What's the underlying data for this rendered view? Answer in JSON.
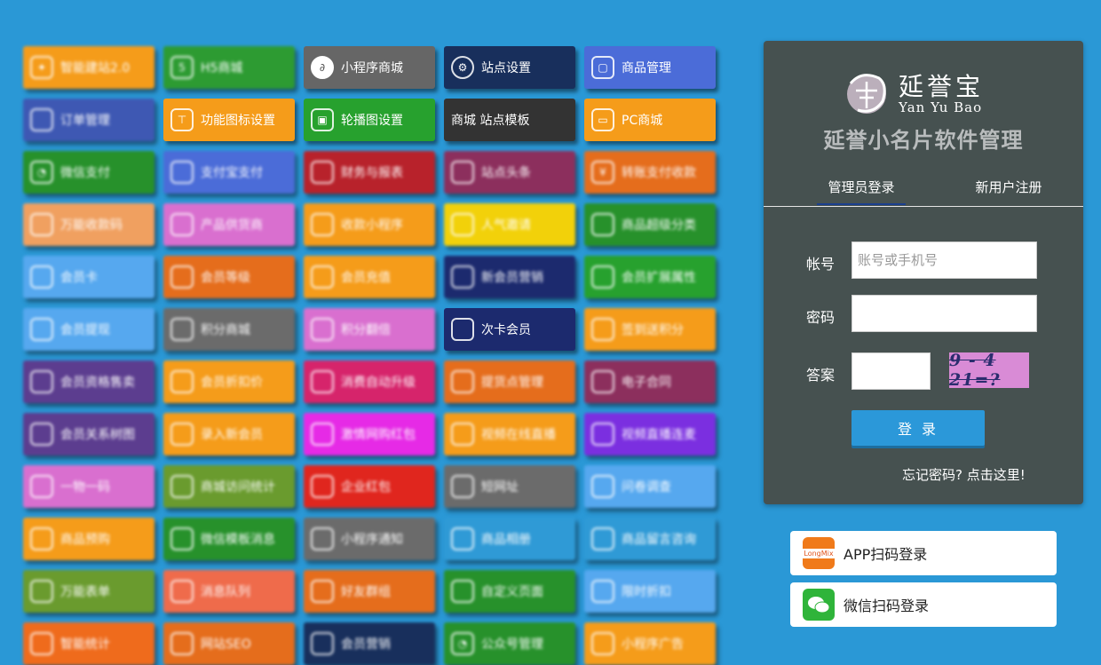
{
  "tiles": [
    {
      "label": "智能建站2.0",
      "color": "#f59c1a",
      "icon": "star-hex-icon",
      "blur": true
    },
    {
      "label": "H5商城",
      "color": "#2d9b32",
      "icon": "html5-icon",
      "blur": true
    },
    {
      "label": "小程序商城",
      "color": "#666666",
      "icon": "mini-program-icon",
      "blur": false
    },
    {
      "label": "站点设置",
      "color": "#182f5c",
      "icon": "gear-icon",
      "blur": false
    },
    {
      "label": "商品管理",
      "color": "#4b6cd8",
      "icon": "bag-icon",
      "blur": false
    },
    {
      "label": "订单管理",
      "color": "#3e58b3",
      "icon": "user-list-icon",
      "blur": true
    },
    {
      "label": "功能图标设置",
      "color": "#f59c1a",
      "icon": "signpost-icon",
      "blur": false
    },
    {
      "label": "轮播图设置",
      "color": "#27a12e",
      "icon": "image-icon",
      "blur": false
    },
    {
      "label": "商城 站点模板",
      "color": "#333333",
      "icon": "",
      "blur": false
    },
    {
      "label": "PC商城",
      "color": "#f59c1a",
      "icon": "monitor-icon",
      "blur": false
    },
    {
      "label": "微信支付",
      "color": "#27912b",
      "icon": "wechat-icon",
      "blur": true
    },
    {
      "label": "支付宝支付",
      "color": "#4b6cd8",
      "icon": "alipay-icon",
      "blur": true
    },
    {
      "label": "财务与报表",
      "color": "#b8222b",
      "icon": "report-icon",
      "blur": true
    },
    {
      "label": "站点头条",
      "color": "#8c2f5d",
      "icon": "grid-icon",
      "blur": true
    },
    {
      "label": "转账支付收款",
      "color": "#e56d1c",
      "icon": "yen-icon",
      "blur": true
    },
    {
      "label": "万能收款码",
      "color": "#f0a060",
      "icon": "qr-icon",
      "blur": true
    },
    {
      "label": "产品供货商",
      "color": "#d96fcf",
      "icon": "store-icon",
      "blur": true
    },
    {
      "label": "收款小程序",
      "color": "#f59c1a",
      "icon": "wallet-icon",
      "blur": true
    },
    {
      "label": "人气邀请",
      "color": "#f2d10a",
      "icon": "crown-icon",
      "blur": true
    },
    {
      "label": "商品超级分类",
      "color": "#27912b",
      "icon": "tag-icon",
      "blur": true
    },
    {
      "label": "会员卡",
      "color": "#56a8ef",
      "icon": "card-icon",
      "blur": true
    },
    {
      "label": "会员等级",
      "color": "#e56d1c",
      "icon": "medal-icon",
      "blur": true
    },
    {
      "label": "会员充值",
      "color": "#f59c1a",
      "icon": "recharge-icon",
      "blur": true
    },
    {
      "label": "新会员营销",
      "color": "#1c2a6e",
      "icon": "gift-icon",
      "blur": true
    },
    {
      "label": "会员扩展属性",
      "color": "#27a12e",
      "icon": "puzzle-icon",
      "blur": true
    },
    {
      "label": "会员提现",
      "color": "#56a8ef",
      "icon": "money-bag-icon",
      "blur": true
    },
    {
      "label": "积分商城",
      "color": "#6b6b6b",
      "icon": "coin-icon",
      "blur": true
    },
    {
      "label": "积分翻倍",
      "color": "#d96fcf",
      "icon": "chart-icon",
      "blur": true
    },
    {
      "label": "次卡会员",
      "color": "#1c2a6e",
      "icon": "ticket-icon",
      "blur": false
    },
    {
      "label": "签到送积分",
      "color": "#f59c1a",
      "icon": "calendar-icon",
      "blur": true
    },
    {
      "label": "会员资格售卖",
      "color": "#5c3d8f",
      "icon": "box-icon",
      "blur": true
    },
    {
      "label": "会员折扣价",
      "color": "#f59c1a",
      "icon": "discount-icon",
      "blur": true
    },
    {
      "label": "消费自动升级",
      "color": "#d6246b",
      "icon": "trend-icon",
      "blur": true
    },
    {
      "label": "提货点管理",
      "color": "#e56d1c",
      "icon": "cart-icon",
      "blur": true
    },
    {
      "label": "电子合同",
      "color": "#8c2f5d",
      "icon": "contract-icon",
      "blur": true
    },
    {
      "label": "会员关系树图",
      "color": "#5c3d8f",
      "icon": "tree-icon",
      "blur": true
    },
    {
      "label": "录入新会员",
      "color": "#f59c1a",
      "icon": "user-add-icon",
      "blur": true
    },
    {
      "label": "激情网购红包",
      "color": "#e62ae6",
      "icon": "redpacket-icon",
      "blur": true
    },
    {
      "label": "视频在线直播",
      "color": "#f59c1a",
      "icon": "video-icon",
      "blur": true
    },
    {
      "label": "视频直播连麦",
      "color": "#7b2fe0",
      "icon": "play-icon",
      "blur": true
    },
    {
      "label": "一物一码",
      "color": "#d96fcf",
      "icon": "scan-icon",
      "blur": true
    },
    {
      "label": "商城访问统计",
      "color": "#6a9b2e",
      "icon": "stats-icon",
      "blur": true
    },
    {
      "label": "企业红包",
      "color": "#e0261e",
      "icon": "envelope-icon",
      "blur": true
    },
    {
      "label": "短网址",
      "color": "#6b6b6b",
      "icon": "link-icon",
      "blur": true
    },
    {
      "label": "问卷调查",
      "color": "#56a8ef",
      "icon": "survey-icon",
      "blur": true
    },
    {
      "label": "商品预购",
      "color": "#f59c1a",
      "icon": "basket-icon",
      "blur": true
    },
    {
      "label": "微信模板消息",
      "color": "#27912b",
      "icon": "message-icon",
      "blur": true
    },
    {
      "label": "小程序通知",
      "color": "#6b6b6b",
      "icon": "bell-icon",
      "blur": true
    },
    {
      "label": "商品相册",
      "color": "#2f9ad6",
      "icon": "album-icon",
      "blur": true
    },
    {
      "label": "商品留言咨询",
      "color": "#2f9ad6",
      "icon": "comment-icon",
      "blur": true
    },
    {
      "label": "万能表单",
      "color": "#6a9b2e",
      "icon": "form-icon",
      "blur": true
    },
    {
      "label": "消息队列",
      "color": "#ef6b4b",
      "icon": "queue-icon",
      "blur": true
    },
    {
      "label": "好友群组",
      "color": "#e56d1c",
      "icon": "group-icon",
      "blur": true
    },
    {
      "label": "自定义页面",
      "color": "#27912b",
      "icon": "page-icon",
      "blur": true
    },
    {
      "label": "限时折扣",
      "color": "#56a8ef",
      "icon": "clock-icon",
      "blur": true
    },
    {
      "label": "智能统计",
      "color": "#ef6b1c",
      "icon": "pie-icon",
      "blur": true
    },
    {
      "label": "网站SEO",
      "color": "#e56d1c",
      "icon": "seo-icon",
      "blur": true
    },
    {
      "label": "会员营销",
      "color": "#182f5c",
      "icon": "marketing-icon",
      "blur": true
    },
    {
      "label": "公众号管理",
      "color": "#27912b",
      "icon": "wechat-icon",
      "blur": true
    },
    {
      "label": "小程序广告",
      "color": "#f59c1a",
      "icon": "ad-icon",
      "blur": true
    }
  ],
  "login": {
    "logo_cn": "延誉宝",
    "logo_en": "Yan Yu Bao",
    "title": "延誉小名片软件管理",
    "tab_admin": "管理员登录",
    "tab_register": "新用户注册",
    "account_label": "帐号",
    "account_placeholder": "账号或手机号",
    "password_label": "密码",
    "answer_label": "答案",
    "captcha_text": "9 - 4 21=?",
    "login_button": "登 录",
    "forgot_link": "忘记密码? 点击这里!"
  },
  "qr": {
    "app_label": "APP扫码登录",
    "app_icon_text": "LongMix",
    "wechat_label": "微信扫码登录"
  }
}
